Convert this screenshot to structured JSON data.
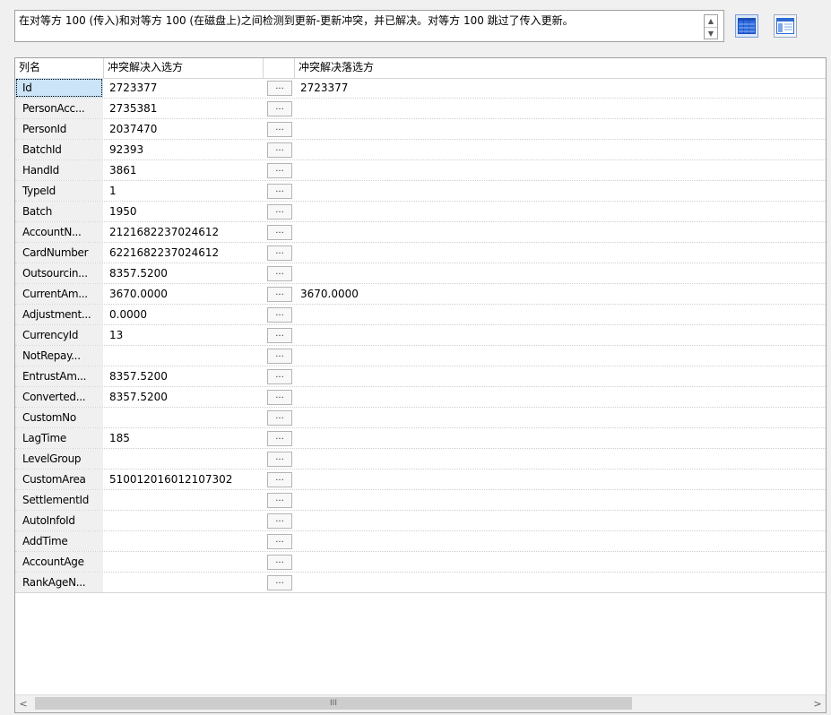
{
  "message": "在对等方 100 (传入)和对等方 100 (在磁盘上)之间检测到更新-更新冲突，并已解决。对等方 100 跳过了传入更新。",
  "grid": {
    "headers": {
      "name": "列名",
      "incoming": "冲突解决入选方",
      "losing": "冲突解决落选方"
    },
    "button_label": "...",
    "rows": [
      {
        "name": "Id",
        "incoming": "2723377",
        "losing": "2723377"
      },
      {
        "name": "PersonAcc...",
        "incoming": "2735381",
        "losing": ""
      },
      {
        "name": "PersonId",
        "incoming": "2037470",
        "losing": ""
      },
      {
        "name": "BatchId",
        "incoming": "92393",
        "losing": ""
      },
      {
        "name": "HandId",
        "incoming": "3861",
        "losing": ""
      },
      {
        "name": "TypeId",
        "incoming": "1",
        "losing": ""
      },
      {
        "name": "Batch",
        "incoming": "1950",
        "losing": ""
      },
      {
        "name": "AccountN...",
        "incoming": "2121682237024612",
        "losing": ""
      },
      {
        "name": "CardNumber",
        "incoming": "6221682237024612",
        "losing": ""
      },
      {
        "name": "Outsourcin...",
        "incoming": "8357.5200",
        "losing": ""
      },
      {
        "name": "CurrentAm...",
        "incoming": "3670.0000",
        "losing": "3670.0000"
      },
      {
        "name": "Adjustment...",
        "incoming": "0.0000",
        "losing": ""
      },
      {
        "name": "CurrencyId",
        "incoming": "13",
        "losing": ""
      },
      {
        "name": "NotRepay...",
        "incoming": "",
        "losing": ""
      },
      {
        "name": "EntrustAm...",
        "incoming": "8357.5200",
        "losing": ""
      },
      {
        "name": "Converted...",
        "incoming": "8357.5200",
        "losing": ""
      },
      {
        "name": "CustomNo",
        "incoming": "",
        "losing": ""
      },
      {
        "name": "LagTime",
        "incoming": "185",
        "losing": ""
      },
      {
        "name": "LevelGroup",
        "incoming": "",
        "losing": ""
      },
      {
        "name": "CustomArea",
        "incoming": "510012016012107302",
        "losing": ""
      },
      {
        "name": "SettlementId",
        "incoming": "",
        "losing": ""
      },
      {
        "name": "AutoInfoId",
        "incoming": "",
        "losing": ""
      },
      {
        "name": "AddTime",
        "incoming": "",
        "losing": ""
      },
      {
        "name": "AccountAge",
        "incoming": "",
        "losing": ""
      },
      {
        "name": "RankAgeN...",
        "incoming": "",
        "losing": ""
      }
    ]
  },
  "scrollbar": {
    "left_arrow": "<",
    "right_arrow": ">",
    "grip": "III"
  },
  "icons": {
    "detail_view": "columns-view-icon",
    "table_view": "table-view-icon"
  }
}
